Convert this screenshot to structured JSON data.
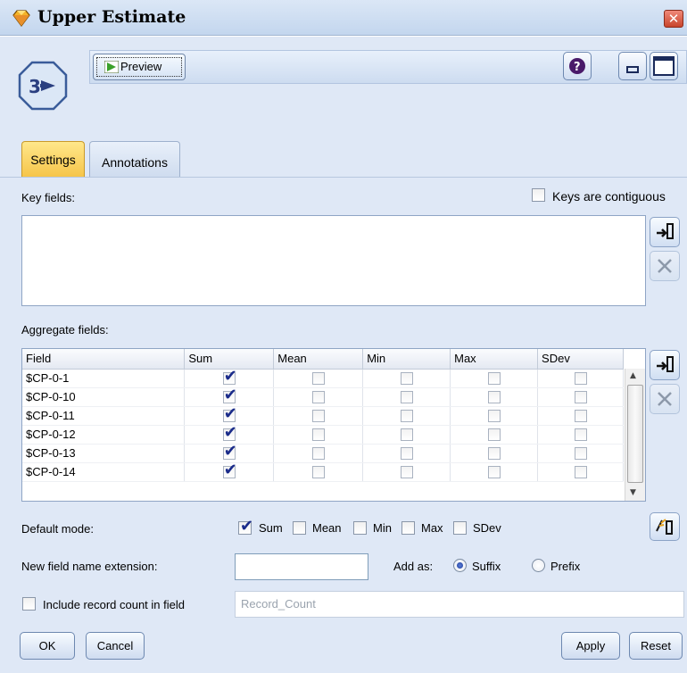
{
  "window": {
    "title": "Upper Estimate",
    "close_glyph": "✕"
  },
  "toolbar": {
    "preview_label": "Preview"
  },
  "tabs": [
    {
      "label": "Settings",
      "active": true
    },
    {
      "label": "Annotations",
      "active": false
    }
  ],
  "key_fields": {
    "label": "Key fields:",
    "contiguous_label": "Keys are contiguous",
    "contiguous_checked": false
  },
  "aggregate": {
    "label": "Aggregate fields:",
    "columns": [
      "Field",
      "Sum",
      "Mean",
      "Min",
      "Max",
      "SDev"
    ],
    "rows": [
      {
        "field": "$CP-0-1",
        "sum": true,
        "mean": false,
        "min": false,
        "max": false,
        "sdev": false
      },
      {
        "field": "$CP-0-10",
        "sum": true,
        "mean": false,
        "min": false,
        "max": false,
        "sdev": false
      },
      {
        "field": "$CP-0-11",
        "sum": true,
        "mean": false,
        "min": false,
        "max": false,
        "sdev": false
      },
      {
        "field": "$CP-0-12",
        "sum": true,
        "mean": false,
        "min": false,
        "max": false,
        "sdev": false
      },
      {
        "field": "$CP-0-13",
        "sum": true,
        "mean": false,
        "min": false,
        "max": false,
        "sdev": false
      },
      {
        "field": "$CP-0-14",
        "sum": true,
        "mean": false,
        "min": false,
        "max": false,
        "sdev": false
      }
    ]
  },
  "default_mode": {
    "label": "Default mode:",
    "sum": "Sum",
    "mean": "Mean",
    "min": "Min",
    "max": "Max",
    "sdev": "SDev"
  },
  "extension": {
    "label": "New field name extension:",
    "value": "",
    "add_as_label": "Add as:",
    "suffix": "Suffix",
    "prefix": "Prefix",
    "selected": "Suffix"
  },
  "record_count": {
    "label": "Include record count in field",
    "placeholder": "Record_Count",
    "checked": false
  },
  "buttons": {
    "ok": "OK",
    "cancel": "Cancel",
    "apply": "Apply",
    "reset": "Reset"
  },
  "colors": {
    "accent_tab": "#f6c54a",
    "panel": "#dfe8f6",
    "check": "#1a2b8a"
  },
  "icons": [
    "app-gem-icon",
    "aggregate-node-icon",
    "preview-play-icon",
    "help-icon",
    "minimize-icon",
    "maximize-icon",
    "pick-field-icon",
    "delete-icon",
    "apply-default-icon"
  ]
}
